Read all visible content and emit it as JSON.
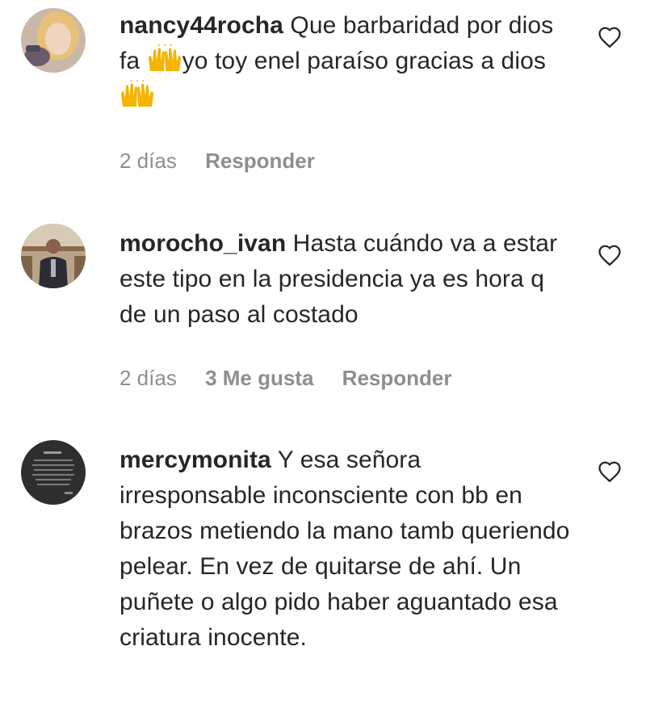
{
  "comments": [
    {
      "username": "nancy44rocha",
      "text_part1": " Que barbaridad por dios fa ",
      "text_part2": "yo toy enel paraíso gracias a dios ",
      "emojis": [
        "raising-hands-emoji",
        "raising-hands-emoji"
      ],
      "time": "2 días",
      "likes": "",
      "reply_label": "Responder"
    },
    {
      "username": "morocho_ivan",
      "text": " Hasta cuándo va a estar este tipo en la presidencia ya es hora q de un paso al costado",
      "time": "2 días",
      "likes": "3 Me gusta",
      "reply_label": "Responder"
    },
    {
      "username": "mercymonita",
      "text": " Y esa señora irresponsable inconsciente con bb en brazos metiendo la mano tamb queriendo pelear. En vez de quitarse de ahí. Un puñete o algo pido haber aguantado esa criatura inocente.",
      "time": "",
      "likes": "",
      "reply_label": ""
    }
  ],
  "icons": {
    "like": "heart-outline-icon"
  }
}
